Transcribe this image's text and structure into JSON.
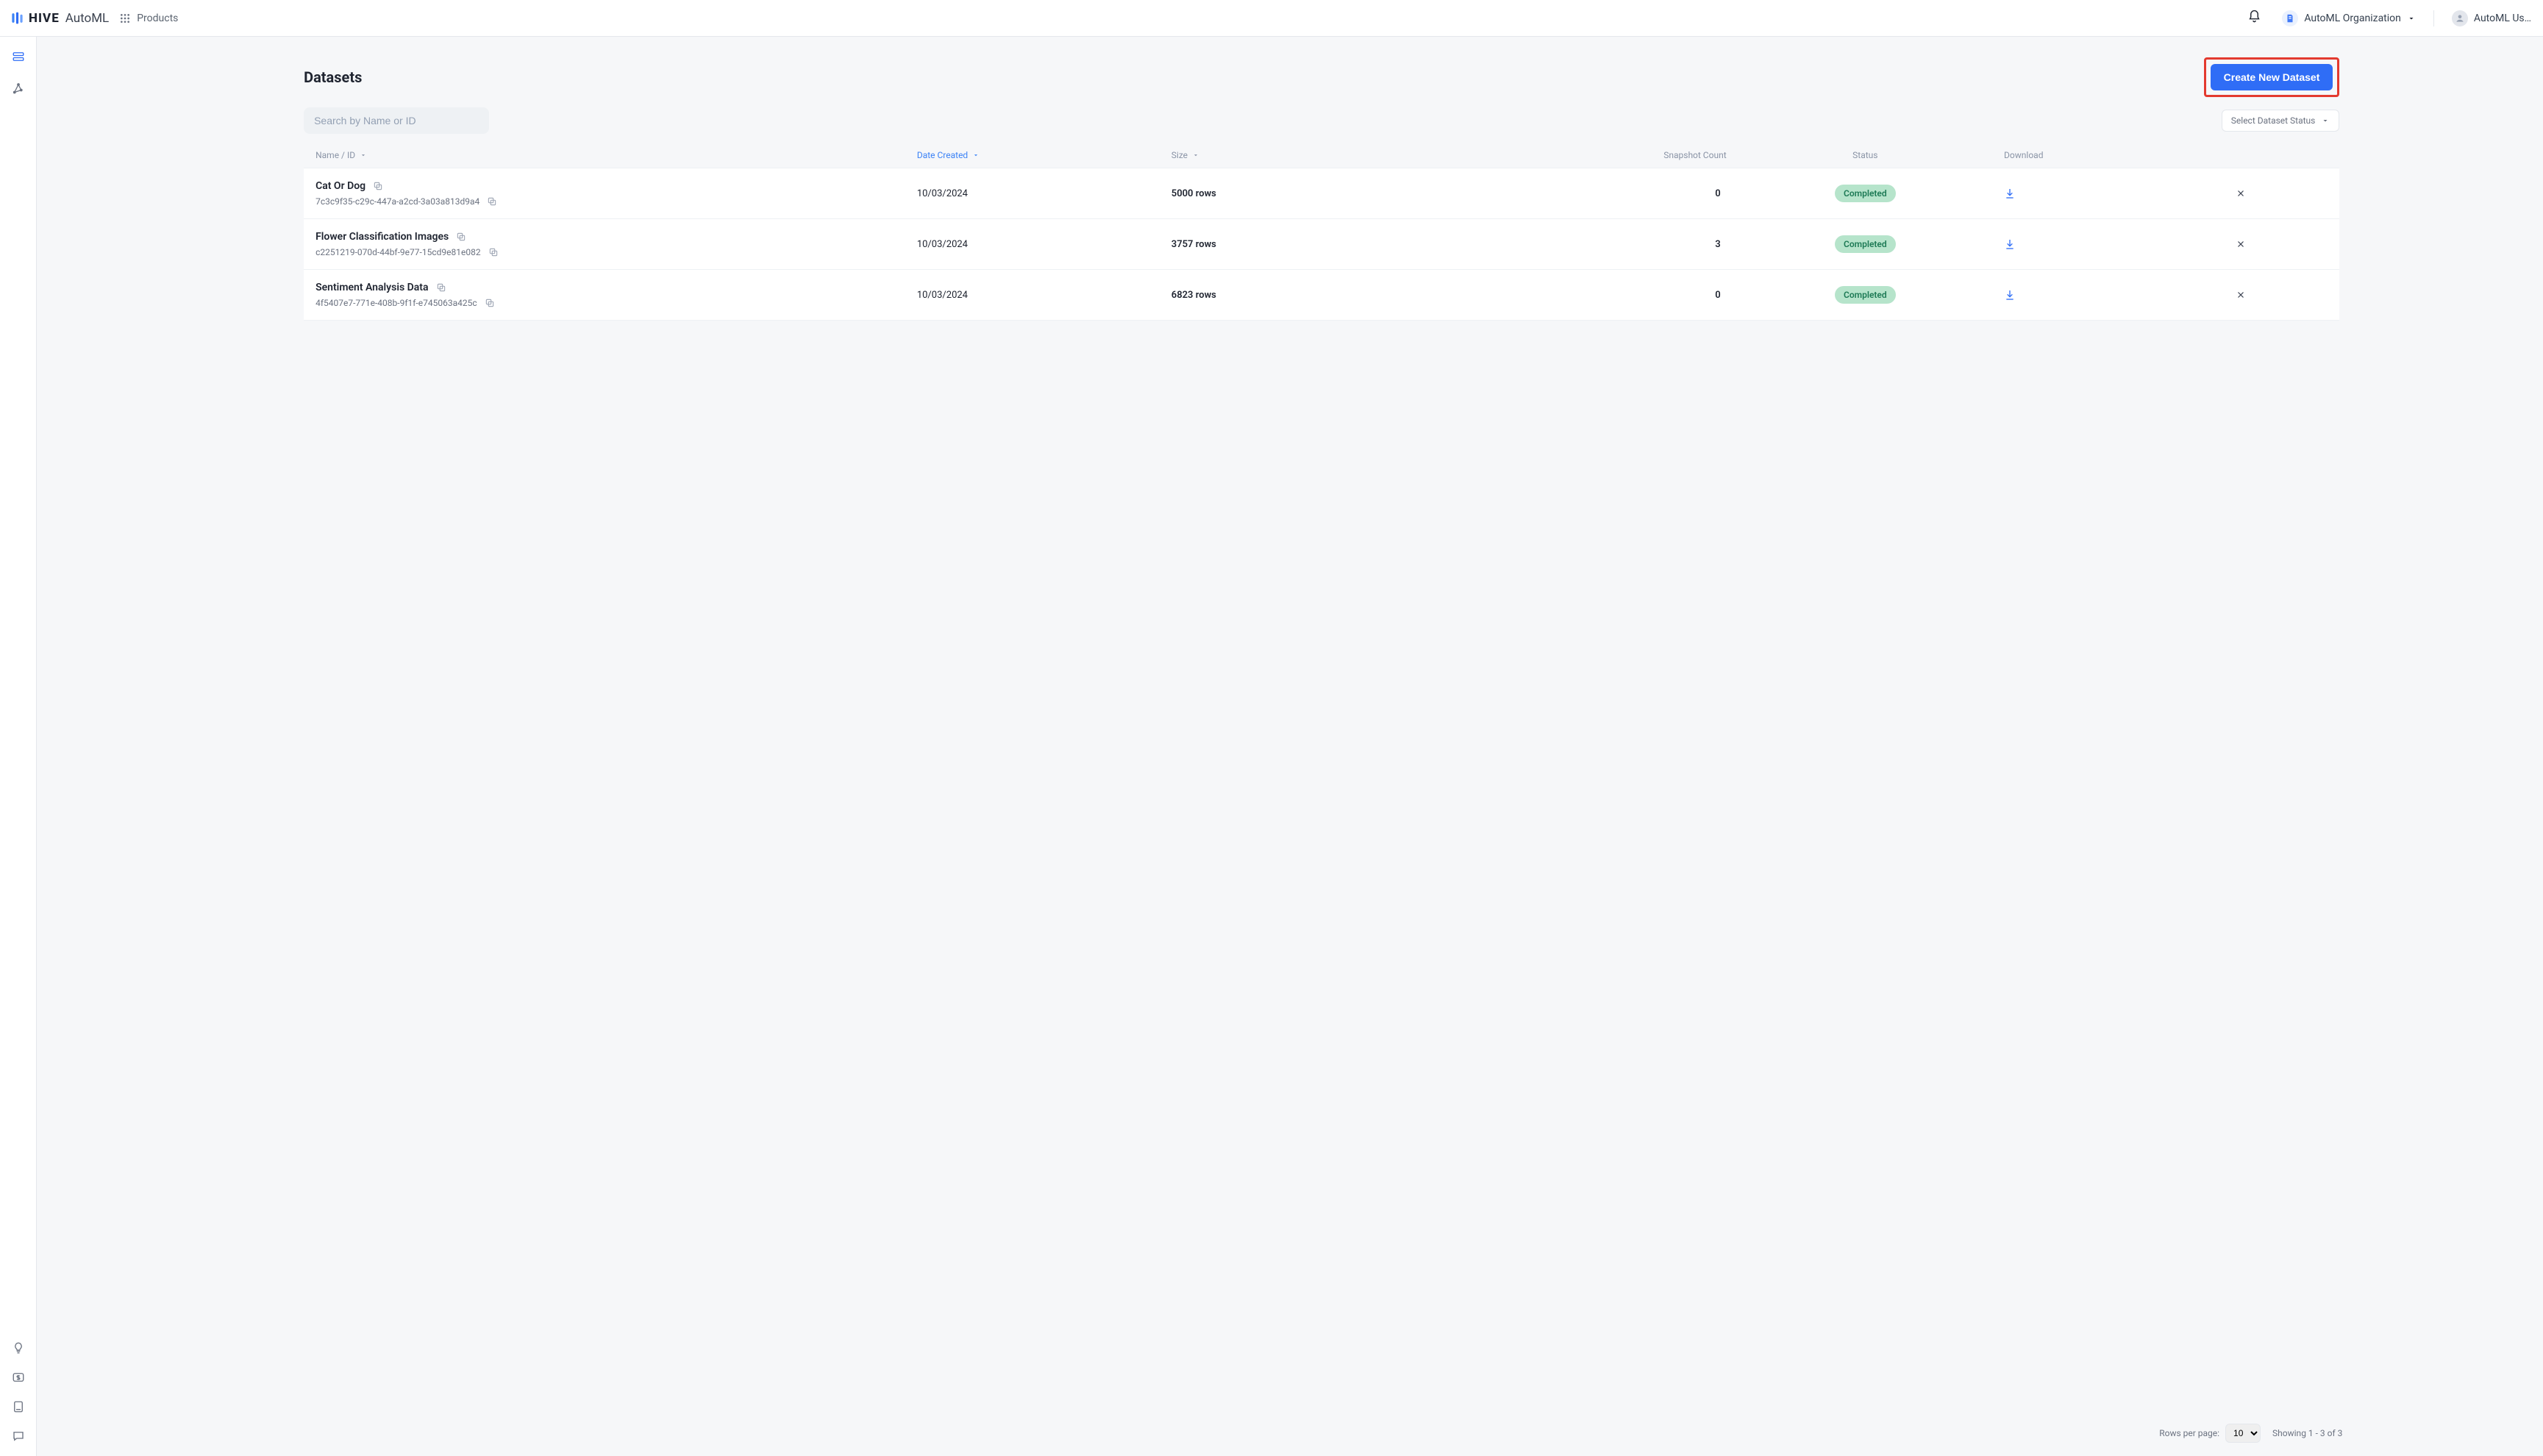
{
  "brand": {
    "name": "HIVE",
    "product": "AutoML"
  },
  "topbar": {
    "products_label": "Products",
    "organization": "AutoML Organization",
    "user": "AutoML Us…"
  },
  "page": {
    "title": "Datasets",
    "create_button": "Create New Dataset",
    "search_placeholder": "Search by Name or ID",
    "status_filter_label": "Select Dataset Status"
  },
  "table": {
    "columns": {
      "name_id": "Name / ID",
      "date_created": "Date Created",
      "size": "Size",
      "snapshot_count": "Snapshot Count",
      "status": "Status",
      "download": "Download"
    },
    "sorted_by": "date_created",
    "rows": [
      {
        "name": "Cat Or Dog",
        "id": "7c3c9f35-c29c-447a-a2cd-3a03a813d9a4",
        "date_created": "10/03/2024",
        "size": "5000 rows",
        "snapshot_count": "0",
        "status": "Completed"
      },
      {
        "name": "Flower Classification Images",
        "id": "c2251219-070d-44bf-9e77-15cd9e81e082",
        "date_created": "10/03/2024",
        "size": "3757 rows",
        "snapshot_count": "3",
        "status": "Completed"
      },
      {
        "name": "Sentiment Analysis Data",
        "id": "4f5407e7-771e-408b-9f1f-e745063a425c",
        "date_created": "10/03/2024",
        "size": "6823 rows",
        "snapshot_count": "0",
        "status": "Completed"
      }
    ]
  },
  "pagination": {
    "rows_per_page_label": "Rows per page:",
    "rows_per_page_value": "10",
    "showing_text": "Showing 1 - 3 of 3"
  }
}
